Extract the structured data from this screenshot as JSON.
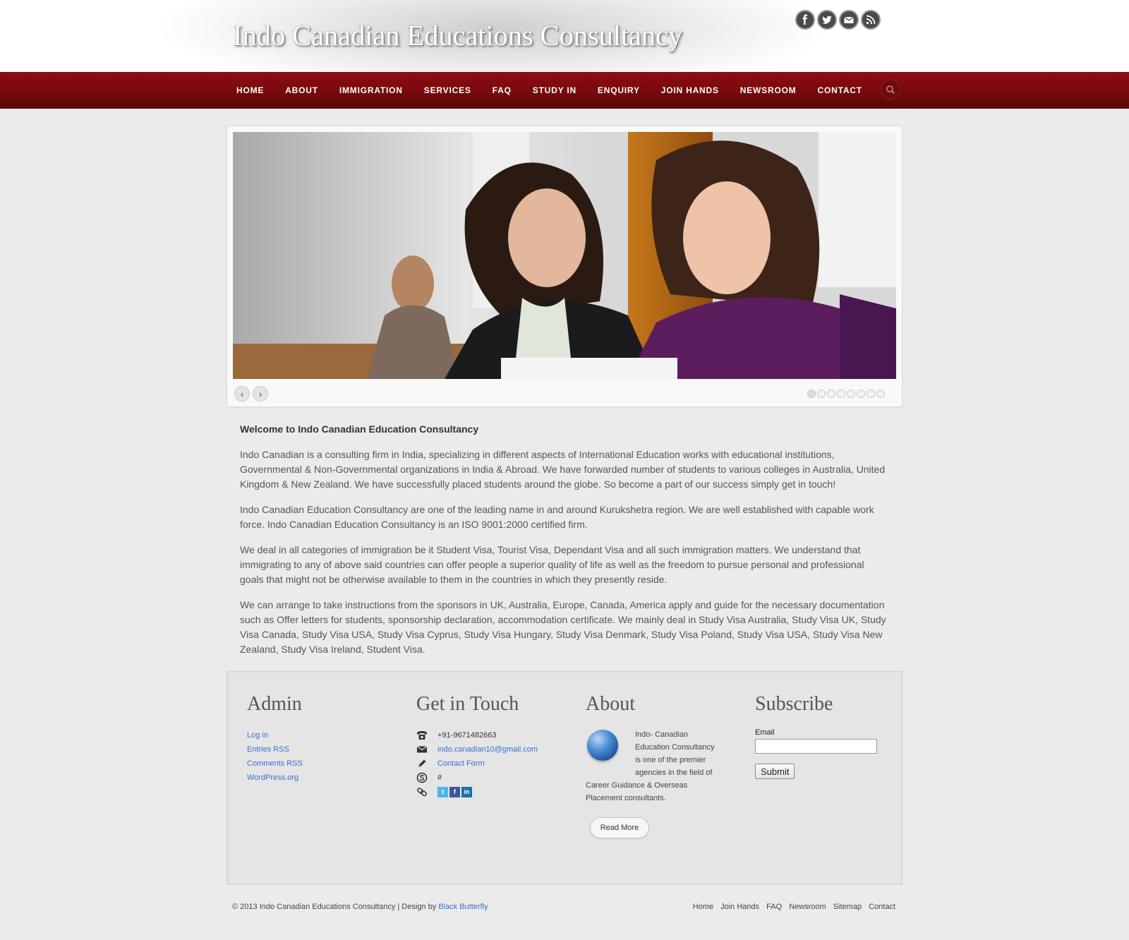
{
  "header": {
    "site_title": "Indo Canadian Educations Consultancy",
    "social": [
      "facebook-icon",
      "twitter-icon",
      "email-icon",
      "rss-icon"
    ]
  },
  "nav": {
    "items": [
      "HOME",
      "ABOUT",
      "IMMIGRATION",
      "SERVICES",
      "FAQ",
      "STUDY IN",
      "ENQUIRY",
      "JOIN HANDS",
      "NEWSROOM",
      "CONTACT"
    ]
  },
  "slider": {
    "prev": "‹",
    "next": "›",
    "slide_count": 8,
    "active_index": 0
  },
  "content": {
    "heading": "Welcome to Indo Canadian Education Consultancy",
    "paragraphs": [
      "Indo Canadian is a consulting firm in India, specializing in different aspects of International Education works with educational institutions, Governmental & Non-Governmental organizations in India & Abroad. We have forwarded number of students to various colleges in Australia, United Kingdom & New Zealand. We have successfully placed students around the globe. So become a part of our success simply get in touch!",
      "Indo Canadian Education Consultancy are one of the leading name in and around Kurukshetra region. We are well established with capable work force. Indo Canadian Education Consultancy is an ISO 9001:2000 certified firm.",
      "We deal in all categories of immigration be it Student Visa, Tourist Visa, Dependant Visa and all such immigration matters. We understand that immigrating to any of above said countries can offer people a superior quality of life as well as the freedom to pursue personal and professional goals that might not be otherwise available to them in the countries in which they presently reside.",
      "We can arrange to take instructions from the sponsors in UK, Australia, Europe, Canada, America apply and guide for the necessary documentation such as Offer letters for students, sponsorship declaration, accommodation certificate. We mainly deal in Study Visa Australia, Study Visa UK, Study Visa Canada, Study Visa USA, Study Visa Cyprus, Study Visa Hungary, Study Visa Denmark, Study Visa Poland, Study Visa USA, Study Visa New Zealand, Study Visa Ireland, Student Visa."
    ]
  },
  "footer": {
    "admin": {
      "title": "Admin",
      "links": [
        "Log in",
        "Entries RSS",
        "Comments RSS",
        "WordPress.org"
      ]
    },
    "touch": {
      "title": "Get in Touch",
      "phone": "+91-9671482663",
      "email": "indo.canadian10@gmail.com",
      "contact_form": "Contact Form",
      "skype": "#"
    },
    "about": {
      "title": "About",
      "text_top": "Indo- Canadian Education Consultancy is one of the premier agencies in the field of",
      "text_bottom": "Career Guidance & Overseas Placement consultants.",
      "read_more": "Read More"
    },
    "subscribe": {
      "title": "Subscribe",
      "email_label": "Email",
      "submit": "Submit"
    }
  },
  "bottom": {
    "copyright": "© 2013 Indo Canadian Educations Consultancy | Design by",
    "designer": "Black Butterfly",
    "links": [
      "Home",
      "Join Hands",
      "FAQ",
      "Newsroom",
      "Sitemap",
      "Contact"
    ]
  }
}
